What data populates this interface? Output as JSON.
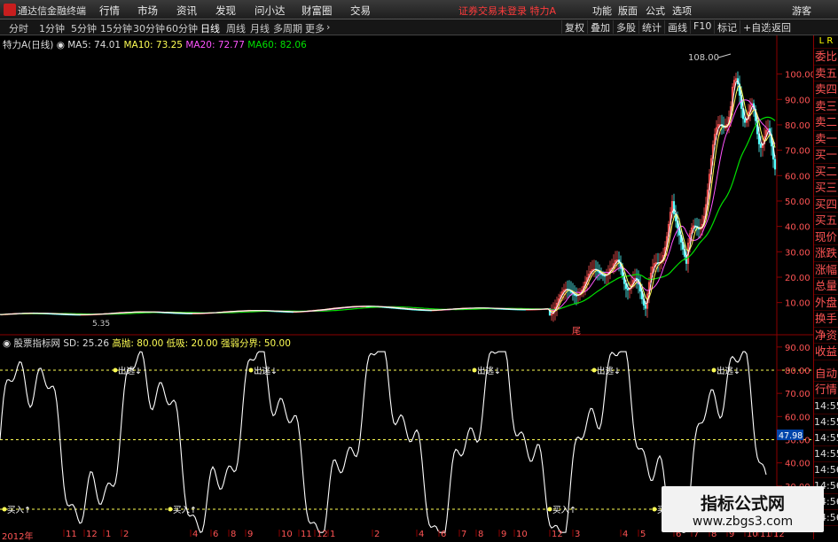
{
  "topbar": {
    "app_title": "通达信金融终端",
    "menus": [
      "行情",
      "市场",
      "资讯",
      "发现",
      "问小达",
      "财富圈",
      "交易"
    ],
    "notice": "证券交易未登录 特力A",
    "tools": [
      "功能",
      "版面",
      "公式",
      "选项"
    ],
    "guest": "游客"
  },
  "periods": [
    "分时",
    "1分钟",
    "5分钟",
    "15分钟",
    "30分钟",
    "60分钟",
    "日线",
    "周线",
    "月线",
    "多周期",
    "更多"
  ],
  "right_buttons": [
    "复权",
    "叠加",
    "多股",
    "统计",
    "画线",
    "F10",
    "标记",
    "+自选",
    "返回"
  ],
  "main_legend": {
    "name": "特力A",
    "period": "(日线)",
    "ma5": "MA5: 74.01",
    "ma10": "MA10: 73.25",
    "ma20": "MA20: 72.77",
    "ma60": "MA60: 82.06"
  },
  "main_axis": [
    "100.00",
    "90.00",
    "80.00",
    "70.00",
    "60.00",
    "50.00",
    "40.00",
    "30.00",
    "20.00",
    "10.00"
  ],
  "peak_label": "108.00",
  "low_label": "5.35",
  "flag_label": "尾",
  "sub_legend": {
    "name": "股票指标网",
    "sd": "SD: 25.26",
    "high": "高抛: 80.00",
    "low": "低吸: 20.00",
    "strong": "强弱分界: 50.00"
  },
  "sub_axis": [
    "90.00",
    "80.00",
    "70.00",
    "60.00",
    "50.00",
    "40.00",
    "30.00"
  ],
  "sub_value": "47.98",
  "sub_right_times": [
    "14:55",
    "14:55",
    "14:55",
    "14:55",
    "14:56",
    "14:56",
    "14:56",
    "14:56"
  ],
  "signals": {
    "sell": "出逃↓",
    "buy": "买入↑"
  },
  "right_tabs": [
    "委比",
    "卖五",
    "卖四",
    "卖三",
    "卖二",
    "卖一",
    "买一",
    "买二",
    "买三",
    "买四",
    "买五",
    "现价",
    "涨跌",
    "涨幅",
    "总量",
    "外盘",
    "换手",
    "净资",
    "收益"
  ],
  "right_tabs2": [
    "自动",
    "行情"
  ],
  "right_top": "L R",
  "date_axis": {
    "year": "2012年",
    "months": [
      "11",
      "12",
      "1",
      "2",
      "4",
      "6",
      "8",
      "9",
      "10",
      "11",
      "12",
      "1",
      "2",
      "4",
      "6",
      "7",
      "8",
      "9",
      "10",
      "12",
      "3",
      "4",
      "5",
      "6",
      "7",
      "8",
      "9",
      "10",
      "11",
      "12",
      "1",
      "2"
    ]
  },
  "watermark": {
    "title": "指标公式网",
    "url": "www.zbgs3.com"
  },
  "colors": {
    "up": "#ff5454",
    "ma5": "#ffffff",
    "ma10": "#ffff54",
    "ma20": "#ff54ff",
    "ma60": "#00e000",
    "indicator": "#ffffff",
    "threshold": "#ffff54"
  }
}
